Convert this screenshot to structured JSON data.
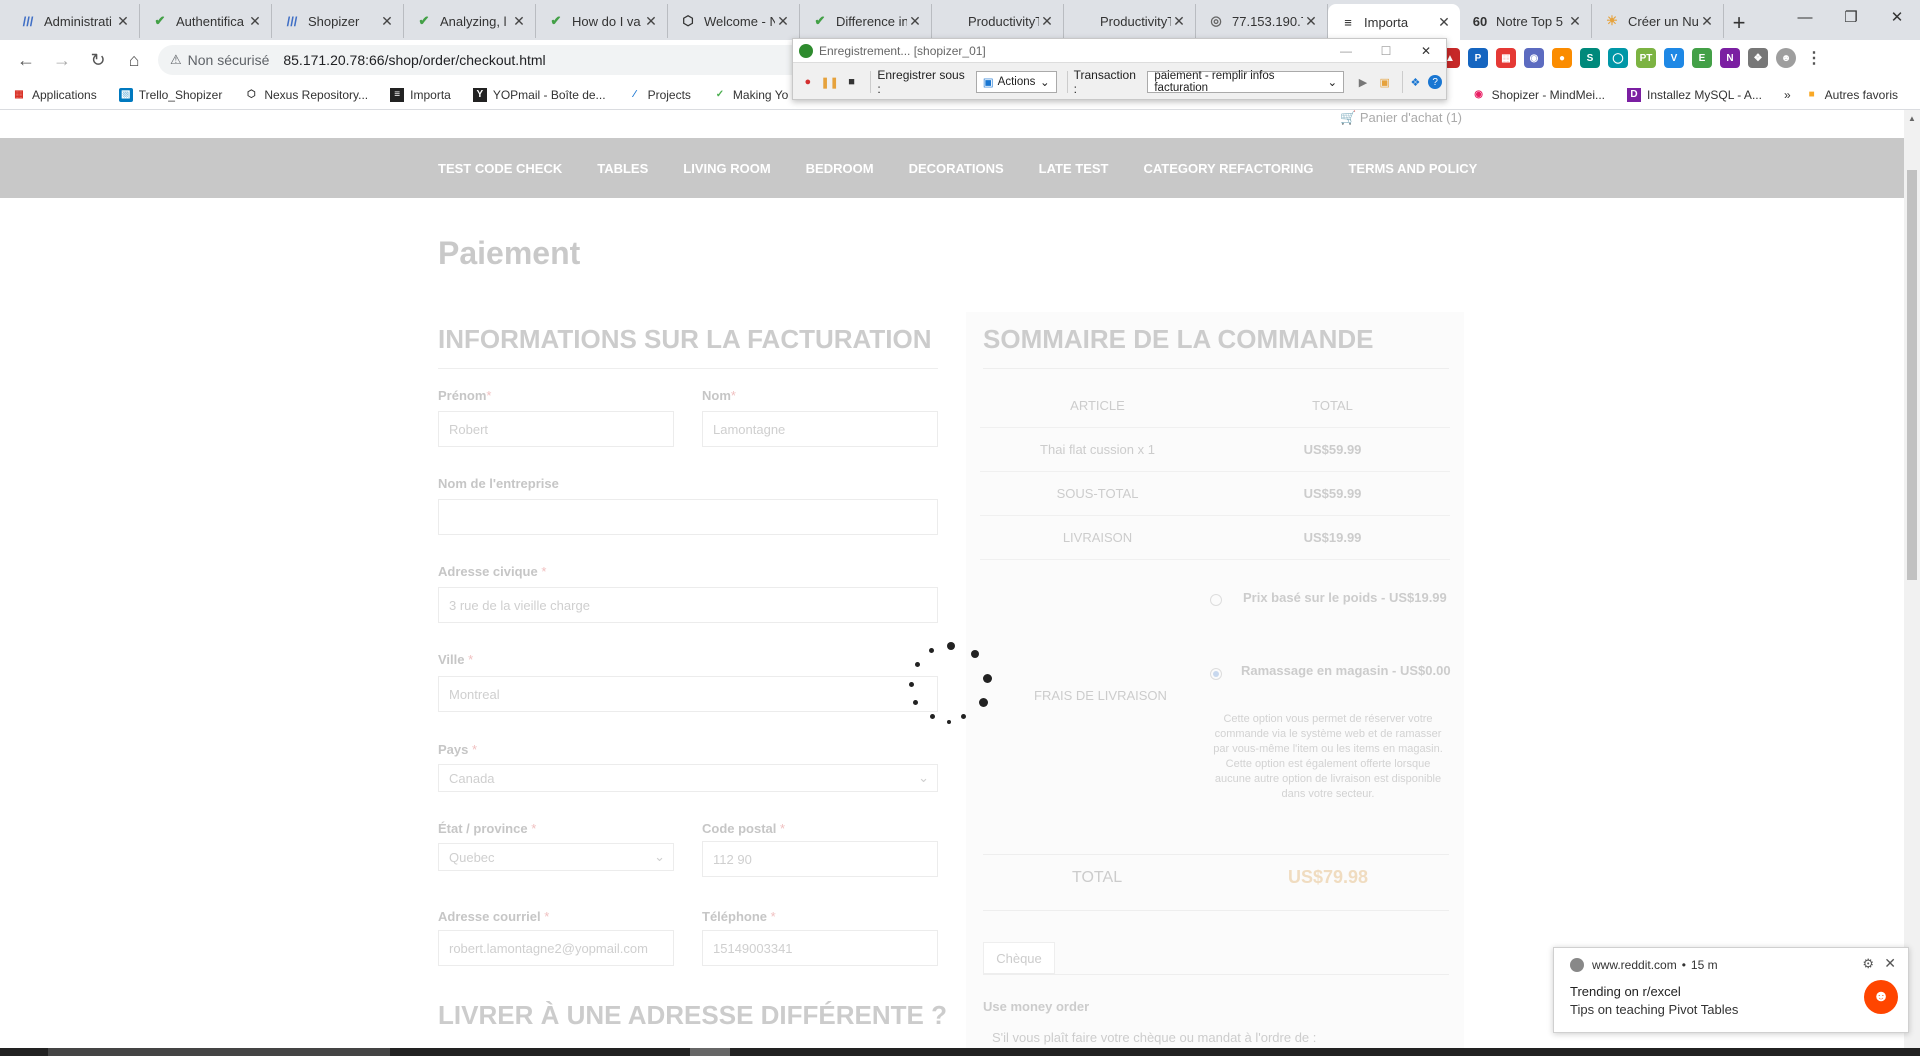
{
  "browser": {
    "tabs": [
      {
        "title": "Administrati",
        "icon": "ptb"
      },
      {
        "title": "Authentifica",
        "icon": "check"
      },
      {
        "title": "Shopizer",
        "icon": "ptb"
      },
      {
        "title": "Analyzing, l",
        "icon": "check"
      },
      {
        "title": "How do I va",
        "icon": "check"
      },
      {
        "title": "Welcome - N",
        "icon": "hex"
      },
      {
        "title": "Difference in",
        "icon": "check"
      },
      {
        "title": "ProductivityTab",
        "icon": "none"
      },
      {
        "title": "ProductivityTab",
        "icon": "none"
      },
      {
        "title": "77.153.190.7",
        "icon": "globe"
      },
      {
        "title": "Importa",
        "icon": "doc"
      },
      {
        "title": "Notre Top 5",
        "icon": "g0"
      },
      {
        "title": "Créer un Nu",
        "icon": "sun"
      }
    ],
    "active_tab_index": 10,
    "not_secure_label": "Non sécurisé",
    "url": "85.171.20.78:66/shop/order/checkout.html",
    "bookmarks": [
      "Applications",
      "Trello_Shopizer",
      "Nexus Repository...",
      "Importa",
      "YOPmail - Boîte de...",
      "Projects",
      "Making Yo"
    ],
    "bookmarks_right": [
      "Shopizer - MindMei...",
      "Installez MySQL - A..."
    ],
    "other_bookmarks": "Autres favoris"
  },
  "recorder": {
    "title": "Enregistrement... [shopizer_01]",
    "save_as_label": "Enregistrer sous :",
    "save_as_value": "Actions",
    "transaction_label": "Transaction :",
    "transaction_value": "paiement - remplir infos facturation"
  },
  "site": {
    "cart_label": "Panier d'achat (1)",
    "nav": [
      "TEST CODE CHECK",
      "TABLES",
      "LIVING ROOM",
      "BEDROOM",
      "DECORATIONS",
      "LATE TEST",
      "CATEGORY REFACTORING",
      "TERMS AND POLICY"
    ]
  },
  "checkout": {
    "page_title": "Paiement",
    "billing_title": "INFORMATIONS SUR LA FACTURATION",
    "fields": {
      "firstname_label": "Prénom",
      "firstname_value": "Robert",
      "lastname_label": "Nom",
      "lastname_value": "Lamontagne",
      "company_label": "Nom de l'entreprise",
      "company_value": "",
      "address_label": "Adresse civique",
      "address_value": "3 rue de la vieille charge",
      "city_label": "Ville",
      "city_value": "Montreal",
      "country_label": "Pays",
      "country_value": "Canada",
      "state_label": "État / province",
      "state_value": "Quebec",
      "postal_label": "Code postal",
      "postal_value": "112 90",
      "email_label": "Adresse courriel",
      "email_value": "robert.lamontagne2@yopmail.com",
      "phone_label": "Téléphone",
      "phone_value": "15149003341"
    },
    "ship_different_title": "LIVRER À UNE ADRESSE DIFFÉRENTE ?"
  },
  "summary": {
    "title": "SOMMAIRE DE LA COMMANDE",
    "col_article": "ARTICLE",
    "col_total": "TOTAL",
    "rows": [
      {
        "label": "Thai flat cussion x 1",
        "value": "US$59.99"
      },
      {
        "label": "SOUS-TOTAL",
        "value": "US$59.99"
      },
      {
        "label": "LIVRAISON",
        "value": "US$19.99"
      }
    ],
    "shipping_fees_label": "FRAIS DE LIVRAISON",
    "shipping_options": [
      {
        "label": "Prix basé sur le poids - US$19.99",
        "selected": false
      },
      {
        "label": "Ramassage en magasin - US$0.00",
        "selected": true
      }
    ],
    "pickup_description": "Cette option vous permet de réserver votre commande via le système web et de ramasser par vous-même l'item ou les items en magasin. Cette option est également offerte lorsque aucune autre option de livraison est disponible dans votre secteur.",
    "total_label": "TOTAL",
    "total_value": "US$79.98",
    "payment_tab": "Chèque",
    "payment_method": "Use money order",
    "payment_note": "S'il vous plaît faire votre chèque ou mandat à l'ordre de :"
  },
  "notification": {
    "source": "www.reddit.com",
    "time": "15 m",
    "title": "Trending on r/excel",
    "body": "Tips on teaching Pivot Tables"
  }
}
